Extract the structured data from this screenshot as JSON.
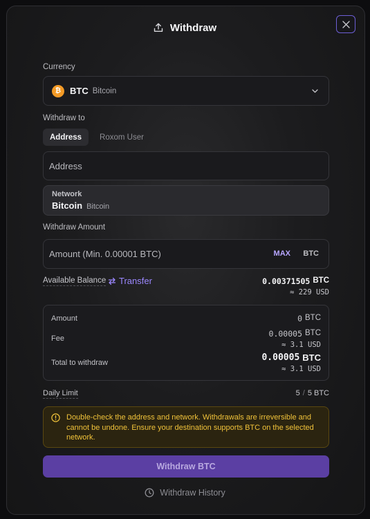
{
  "header": {
    "title": "Withdraw",
    "icon": "upload-icon"
  },
  "currency": {
    "label": "Currency",
    "code": "BTC",
    "name": "Bitcoin",
    "icon_glyph": "₿",
    "icon_color": "#f39a26"
  },
  "withdraw_to": {
    "label": "Withdraw to",
    "tabs": [
      {
        "label": "Address",
        "active": true
      },
      {
        "label": "Roxom User",
        "active": false
      }
    ],
    "address_placeholder": "Address"
  },
  "network": {
    "label": "Network",
    "value": "Bitcoin",
    "sub": "Bitcoin"
  },
  "amount": {
    "label": "Withdraw Amount",
    "placeholder": "Amount (Min. 0.00001 BTC)",
    "max_label": "MAX",
    "unit": "BTC"
  },
  "balance": {
    "label": "Available Balance",
    "transfer_label": "Transfer",
    "btc_value": "0.00371505",
    "btc_unit": "BTC",
    "usd": "≈ 229 USD"
  },
  "summary": {
    "amount_label": "Amount",
    "amount_value": "0",
    "amount_unit": "BTC",
    "fee_label": "Fee",
    "fee_value": "0.00005",
    "fee_unit": "BTC",
    "fee_usd": "≈ 3.1 USD",
    "total_label": "Total to withdraw",
    "total_value": "0.00005",
    "total_unit": "BTC",
    "total_usd": "≈ 3.1 USD"
  },
  "daily_limit": {
    "label": "Daily Limit",
    "used": "5",
    "separator": "/",
    "limit": "5 BTC"
  },
  "warning": {
    "text": "Double-check the address and network. Withdrawals are irreversible and cannot be undone. Ensure your destination supports BTC on the selected network."
  },
  "submit": {
    "label": "Withdraw BTC"
  },
  "history": {
    "label": "Withdraw History"
  },
  "colors": {
    "accent": "#9b87ff",
    "button": "#5b3fa3",
    "warning": "#f0c23a",
    "bitcoin": "#f39a26"
  }
}
